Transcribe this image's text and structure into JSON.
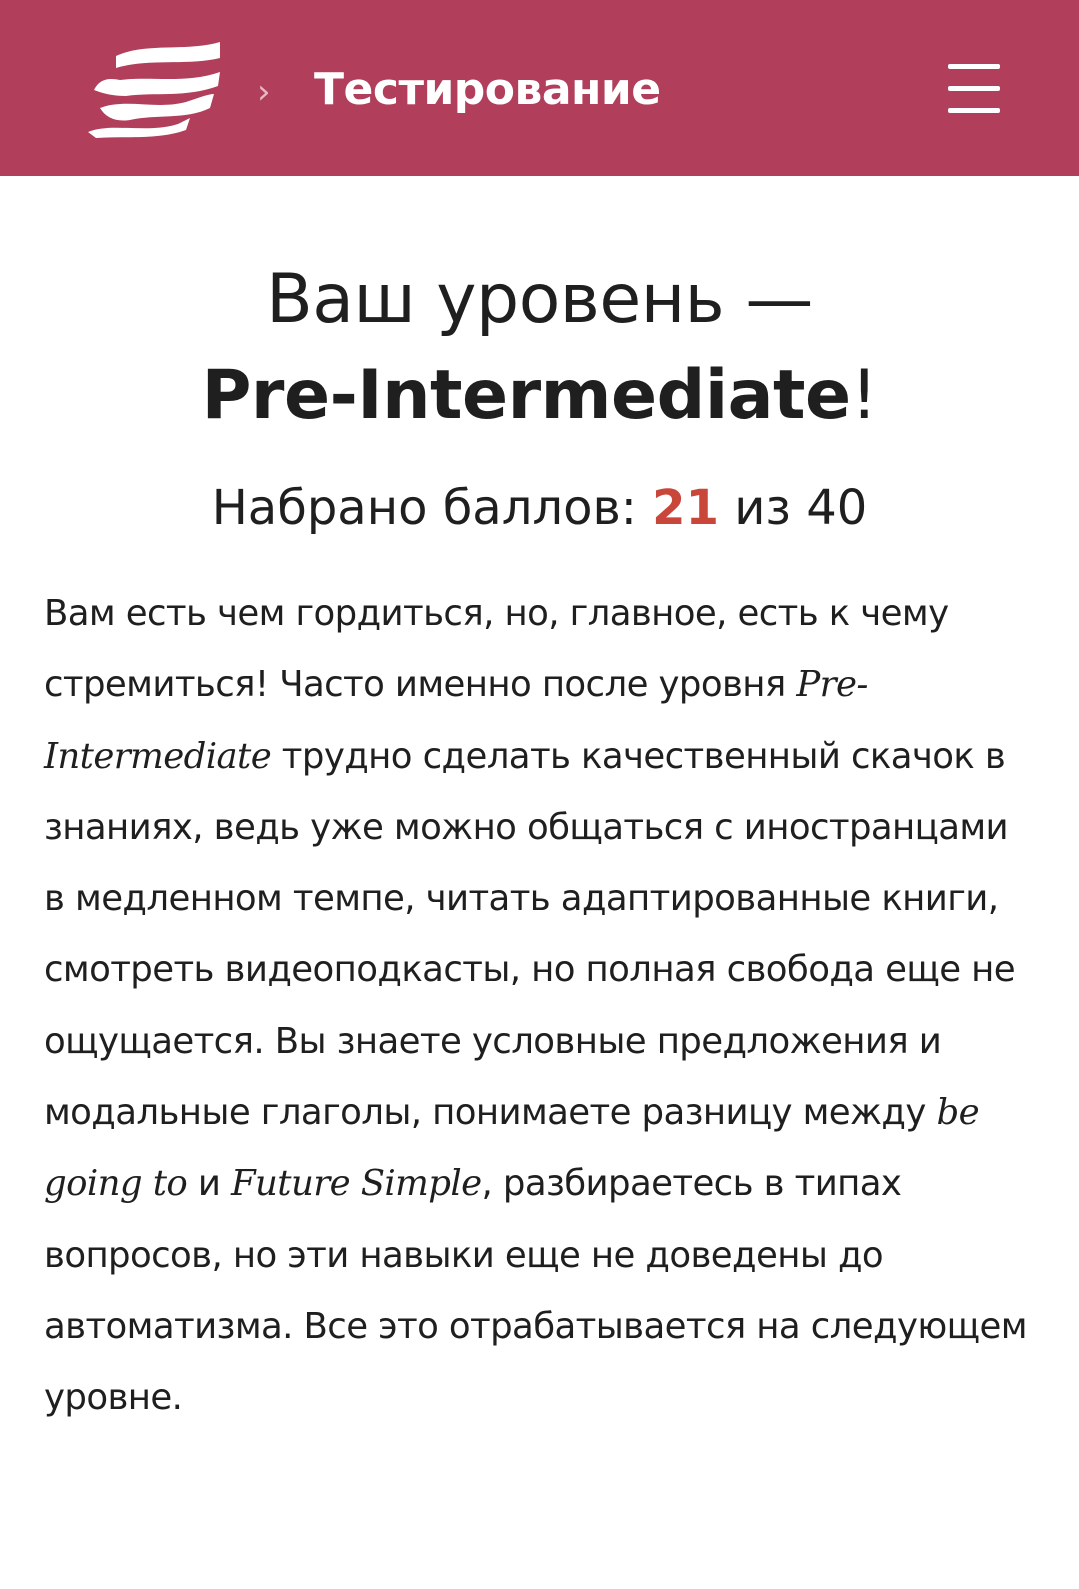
{
  "header": {
    "logo_icon": "wave-flag-logo-icon",
    "breadcrumb_separator": "›",
    "title": "Тестирование",
    "menu_icon": "hamburger-menu-icon",
    "background_color": "#b13e5a"
  },
  "result": {
    "title_prefix": "Ваш уровень —",
    "level": "Pre-Intermediate",
    "title_suffix": "!",
    "score_label": "Набрано баллов:",
    "score_value": "21",
    "score_separator": "из",
    "score_max": "40",
    "score_color": "#c8463a"
  },
  "description": {
    "part1": "Вам есть чем гордиться, но, главное, есть к чему стремиться! Часто именно после уровня ",
    "term1": "Pre-Intermediate",
    "part2": " трудно сделать качественный скачок в знаниях, ведь уже можно общаться с иностранцами в медленном темпе, читать адаптированные книги, смотреть видеоподкасты, но полная свобода еще не ощущается. Вы знаете условные предложения и модальные глаголы, понимаете разницу между ",
    "term2": "be going to",
    "part3": " и ",
    "term3": "Future Simple",
    "part4": ", разбираетесь в типах вопросов, но эти навыки еще не доведены до автоматизма. Все это отрабатывается на следующем уровне."
  }
}
